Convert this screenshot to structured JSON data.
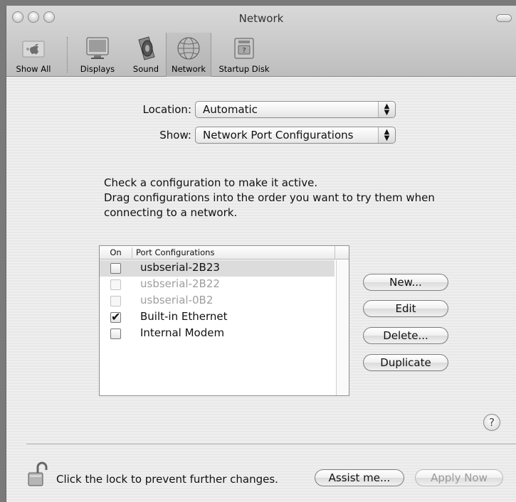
{
  "window": {
    "title": "Network"
  },
  "toolbar": {
    "items": [
      {
        "label": "Show All",
        "icon": "apple-grid-icon"
      },
      {
        "label": "Displays",
        "icon": "display-icon"
      },
      {
        "label": "Sound",
        "icon": "speaker-icon"
      },
      {
        "label": "Network",
        "icon": "network-globe-icon",
        "selected": true
      },
      {
        "label": "Startup Disk",
        "icon": "hard-disk-icon"
      }
    ]
  },
  "form": {
    "location_label": "Location:",
    "location_value": "Automatic",
    "show_label": "Show:",
    "show_value": "Network Port Configurations"
  },
  "instructions": {
    "line1": "Check a configuration to make it active.",
    "line2": "Drag configurations into the order you want to try them when",
    "line3": "connecting to a network."
  },
  "list": {
    "col_on": "On",
    "col_configs": "Port Configurations",
    "rows": [
      {
        "name": "usbserial-2B23",
        "checked": false,
        "enabled": true,
        "selected": true
      },
      {
        "name": "usbserial-2B22",
        "checked": false,
        "enabled": false
      },
      {
        "name": "usbserial-0B2",
        "checked": false,
        "enabled": false
      },
      {
        "name": "Built-in Ethernet",
        "checked": true,
        "enabled": true
      },
      {
        "name": "Internal Modem",
        "checked": false,
        "enabled": true
      }
    ]
  },
  "buttons": {
    "new": "New...",
    "edit": "Edit",
    "delete": "Delete...",
    "duplicate": "Duplicate",
    "help": "?",
    "assist": "Assist me...",
    "apply": "Apply Now"
  },
  "footer": {
    "lock_text": "Click the lock to prevent further changes."
  },
  "colors": {
    "selection_row": "#dcdcdc",
    "window_bg": "#ececec"
  }
}
